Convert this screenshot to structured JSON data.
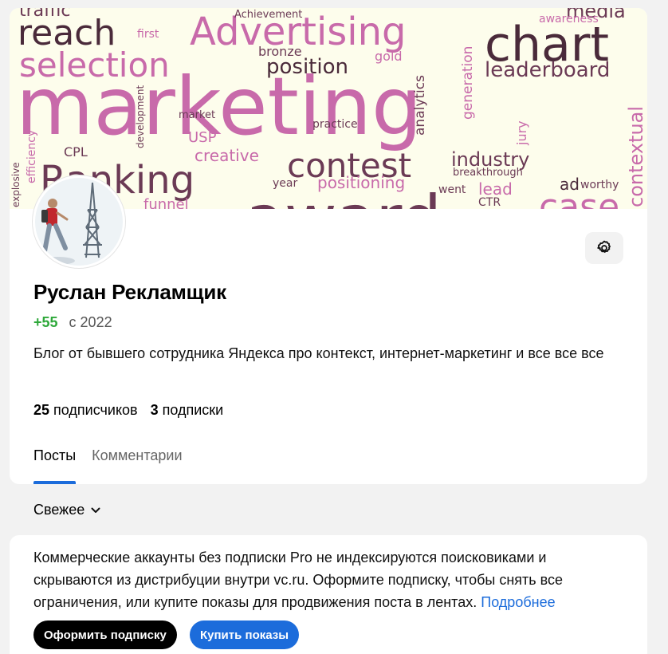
{
  "cover": {
    "words": [
      "traffic",
      "reach",
      "Advertising",
      "chart",
      "media",
      "first",
      "awareness",
      "selection",
      "bronze",
      "position",
      "gold",
      "leaderboard",
      "marketing",
      "generation",
      "analytics",
      "market",
      "USP",
      "practice",
      "development",
      "jury",
      "contextual",
      "efficiency",
      "explosive",
      "CPL",
      "creative",
      "Ranking",
      "contest",
      "industry",
      "breakthrough",
      "year",
      "positioning",
      "award",
      "went",
      "lead",
      "CTR",
      "ad",
      "worthy",
      "case",
      "funnel",
      "Achievement"
    ]
  },
  "profile": {
    "name": "Руслан Рекламщик",
    "rating": "+55",
    "since": "с 2022",
    "bio": "Блог от бывшего сотрудника Яндекса про контекст, интернет-маркетинг и все все все",
    "followers_count": "25",
    "followers_label": "подписчиков",
    "following_count": "3",
    "following_label": "подписки"
  },
  "tabs": [
    {
      "label": "Посты",
      "active": true
    },
    {
      "label": "Комментарии",
      "active": false
    }
  ],
  "sort": {
    "label": "Свежее"
  },
  "notice": {
    "text": "Коммерческие аккаунты без подписки Pro не индексируются поисковиками и скрываются из дистрибуции внутри vc.ru. Оформите подписку, чтобы снять все ограничения, или купите показы для продвижения поста в лентах.",
    "link": "Подробнее",
    "subscribe_button": "Оформить подписку",
    "buy_button": "Купить показы"
  },
  "colors": {
    "accent": "#1c6cdb",
    "rating": "#2ea83a",
    "cover_bg": "#fdfdec",
    "cover_word_pink": "#c86aaa",
    "cover_word_dark": "#6b3a55"
  },
  "icons": {
    "settings": "gear-icon",
    "sort": "chevron-down-icon"
  }
}
